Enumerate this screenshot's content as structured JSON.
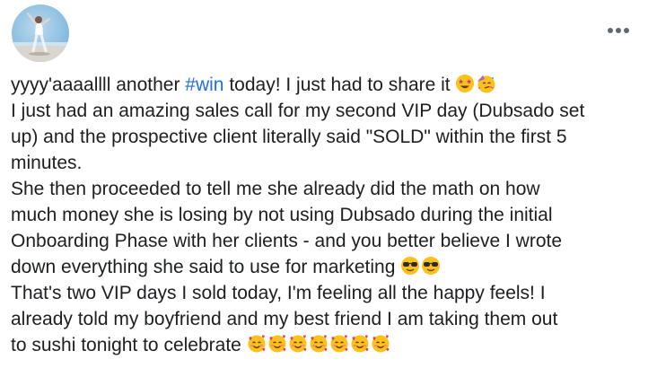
{
  "post": {
    "menu_icon": "more-horizontal-icon",
    "hashtag_color": "#216fdb",
    "lines": {
      "l1_pre": "yyyy'aaaallll another ",
      "l1_hashtag": "#win",
      "l1_post": " today! I just had to share it",
      "l2": "I just had an amazing sales call for my second VIP day (Dubsado set",
      "l3": "up) and the prospective client literally said \"SOLD\" within the first 5",
      "l4": "minutes.",
      "l5": "She then proceeded to tell me she already did the math on how",
      "l6": "much money she is losing by not using Dubsado during the initial",
      "l7": "Onboarding Phase with her clients - and you better believe I wrote",
      "l8": "down everything she said to use for marketing",
      "l9": "That's two VIP days I sold today, I'm feeling all the happy feels! I",
      "l10": "already told my boyfriend and my best friend I am taking them out",
      "l11": "to sushi tonight to celebrate"
    },
    "emojis": {
      "line1": [
        "star-struck-emoji",
        "partying-face-emoji"
      ],
      "line8": [
        "sunglasses-face-emoji",
        "sunglasses-face-emoji"
      ],
      "line11": [
        "smiling-face-with-hearts-emoji",
        "smiling-face-with-hearts-emoji",
        "smiling-face-with-hearts-emoji",
        "smiling-face-with-hearts-emoji",
        "smiling-face-with-hearts-emoji",
        "smiling-face-with-hearts-emoji",
        "smiling-face-with-hearts-emoji"
      ]
    }
  }
}
